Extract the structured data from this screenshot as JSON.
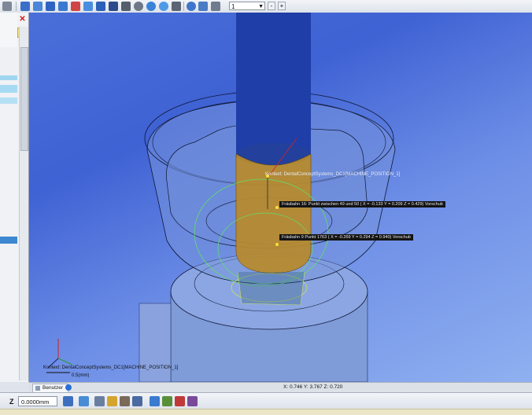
{
  "toolbar": {
    "icons": [
      "open-icon",
      "save-icon",
      "zoom-all-icon",
      "view-front-icon",
      "view-back-icon",
      "view-left-icon",
      "view-right-icon",
      "view-top-icon",
      "view-bottom-icon",
      "zoom-icon",
      "pan-icon",
      "rotate-icon",
      "zoom-fit-icon",
      "measure-icon",
      "layer-icon"
    ],
    "layer_value": "1",
    "minus_label": "-",
    "plus_label": "+"
  },
  "panel": {
    "cancel_label": "✕",
    "ok_label": "✔"
  },
  "viewport": {
    "context_label": "Kontext: DentalConceptSystems_DC1[MACHINE_POSITION_1]",
    "tooltip_path16": "Fräsbahn 16: Punkt zwischen 49 und 50 ( X = -0.133  Y = 0.209  Z = 0.429) Vorschub",
    "tooltip_path9": "Fräsbahn 9 Punkt 1763 ( X = -0.269  Y = 0.294  Z = 0.940) Vorschub",
    "scale_label": "0.5(mm)",
    "bottom_context_label": "Kontext: DentalConceptSystems_DC1[MACHINE_POSITION_1]"
  },
  "status": {
    "tab_label": "Benutzer",
    "coords": "X: 0.746    Y: 3.767    Z: 0.720"
  },
  "bottom_toolbar": {
    "z_label": "Z",
    "z_value": "0.0000mm"
  },
  "colors": {
    "viewport_bg": "#4a6fd9",
    "tool_shaft": "#1f3ea8",
    "tool_tip": "#b98a2a",
    "toolpath": "#5fe06a",
    "tooltip_bg": "#141414"
  }
}
